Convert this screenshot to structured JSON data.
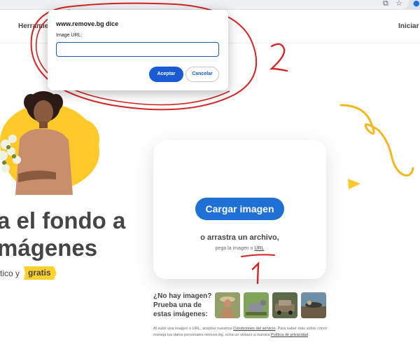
{
  "browser": {
    "icons": [
      "share-icon",
      "star-icon"
    ]
  },
  "nav": {
    "tools": "Herramientas",
    "login": "Iniciar"
  },
  "hero": {
    "headline_1": "a el fondo a",
    "headline_2": "mágenes",
    "sub_prefix": "tico y",
    "free_badge": "gratis"
  },
  "upload": {
    "button": "Cargar imagen",
    "drag_text": "o arrastra un archivo,",
    "paste_prefix": "pega la imagen o ",
    "paste_link": "URL"
  },
  "samples": {
    "no_image": "¿No hay imagen? Prueba una de estas imágenes:",
    "thumbs": [
      "person-with-hat",
      "pigeon",
      "car",
      "table-with-food"
    ]
  },
  "legal": {
    "part1": "Al subir una imagen o URL, aceptas nuestros ",
    "terms": "Condiciones del servicio",
    "part2": ". Para saber más sobre cómo maneja tus datos personales remove.bg, echa un vistazo a nuestra ",
    "privacy": "Política de privacidad",
    "part3": "."
  },
  "dialog": {
    "title": "www.remove.bg dice",
    "label": "Image URL:",
    "input_value": "",
    "ok": "Aceptar",
    "cancel": "Cancelar"
  },
  "colors": {
    "primary": "#1f70d4",
    "yellow": "#ffc929",
    "annotation_red": "#d62424",
    "annotation_yellow": "#f5b71c"
  }
}
